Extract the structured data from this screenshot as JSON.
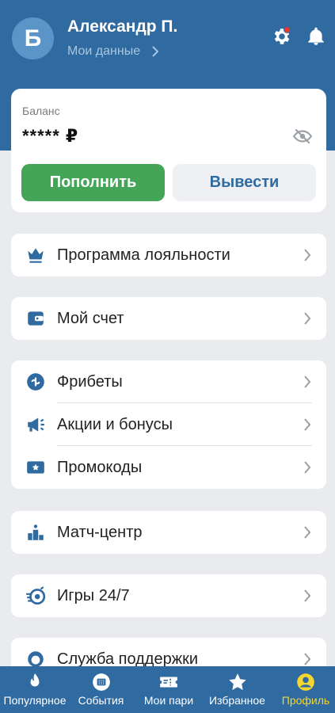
{
  "header": {
    "avatar_letter": "Б",
    "user_name": "Александр П.",
    "my_data_label": "Мои данные",
    "icons": [
      "gear-icon",
      "bell-icon"
    ],
    "notification_dot_color": "#e53935"
  },
  "balance": {
    "label": "Баланс",
    "value": "***** ₽",
    "deposit_label": "Пополнить",
    "withdraw_label": "Вывести",
    "deposit_color": "#44a558"
  },
  "menu": {
    "loyalty": "Программа лояльности",
    "account": "Мой счет",
    "freebets": "Фрибеты",
    "promos": "Акции и бонусы",
    "promocodes": "Промокоды",
    "match_center": "Матч-центр",
    "games": "Игры 24/7",
    "support": "Служба поддержки"
  },
  "bottom_nav": {
    "popular": "Популярное",
    "events": "События",
    "my_bets": "Мои пари",
    "favorites": "Избранное",
    "profile": "Профиль",
    "active_color": "#f5d530"
  },
  "theme": {
    "primary": "#2f6aa0",
    "background": "#e9ebee"
  }
}
